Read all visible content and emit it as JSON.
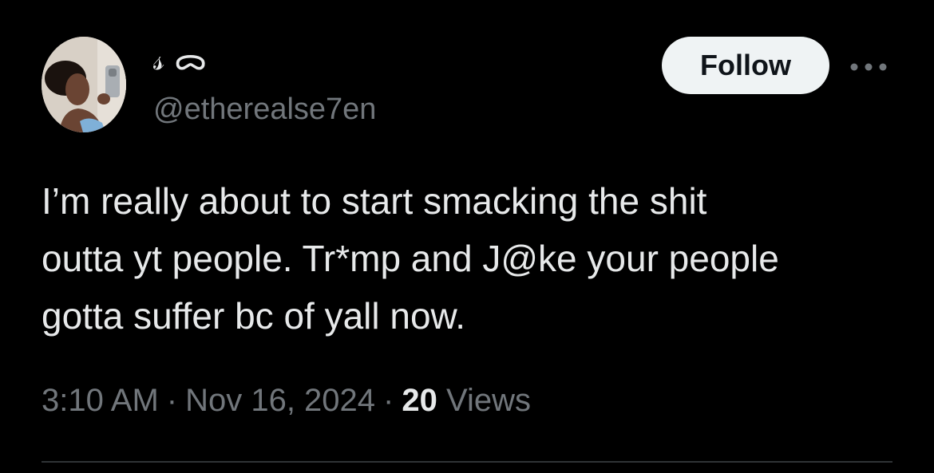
{
  "author": {
    "display_name": "𝓈 ᯅ",
    "handle": "@etherealse7en",
    "avatar_alt": "avatar"
  },
  "actions": {
    "follow_label": "Follow",
    "more_icon": "more-horizontal-icon"
  },
  "tweet": {
    "text": "I’m really about to start smacking the shit\noutta yt people. Tr*mp and J@ke your people\ngotta suffer bc of yall now."
  },
  "meta": {
    "time": "3:10 AM",
    "separator": "·",
    "date": "Nov 16, 2024",
    "views_count": "20",
    "views_label": "Views"
  },
  "colors": {
    "background": "#000000",
    "text_primary": "#e7e9ea",
    "text_secondary": "#71767b",
    "follow_bg": "#eff3f4",
    "follow_text": "#0f1419",
    "divider": "#2f3336"
  }
}
